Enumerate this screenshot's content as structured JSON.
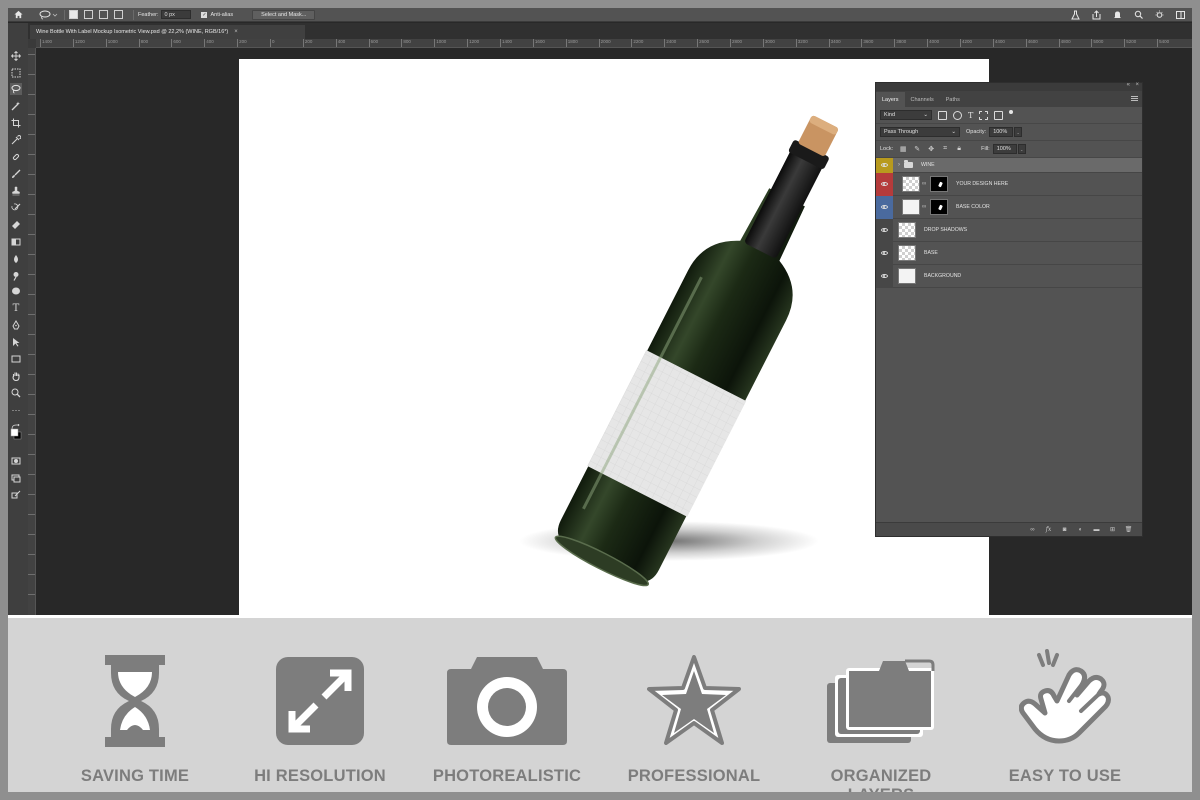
{
  "options_bar": {
    "feather_label": "Feather:",
    "feather_value": "0 px",
    "antialias_label": "Anti-alias",
    "select_mask_label": "Select and Mask..."
  },
  "document": {
    "tab_title": "Wine Bottle With Label Mockup Isometric View.psd @ 22,2% (WINE, RGB/16*)",
    "ruler_ticks": [
      "1400",
      "1200",
      "1000",
      "800",
      "600",
      "400",
      "200",
      "0",
      "200",
      "400",
      "600",
      "800",
      "1000",
      "1200",
      "1400",
      "1600",
      "1800",
      "2000",
      "2200",
      "2400",
      "2600",
      "2800",
      "3000",
      "3200",
      "3400",
      "3600",
      "3800",
      "4000",
      "4200",
      "4400",
      "4600",
      "4800",
      "5000",
      "5200",
      "5400"
    ]
  },
  "layers_panel": {
    "tabs": [
      "Layers",
      "Channels",
      "Paths"
    ],
    "kind_label": "Kind",
    "blend_mode": "Pass Through",
    "opacity_label": "Opacity:",
    "opacity_value": "100%",
    "lock_label": "Lock:",
    "fill_label": "Fill:",
    "fill_value": "100%",
    "layers": [
      {
        "name": "WINE",
        "kind": "group",
        "eye_color": "#b89a1e"
      },
      {
        "name": "YOUR DESIGN HERE",
        "kind": "smart",
        "eye_color": "#b53b3b"
      },
      {
        "name": "BASE COLOR",
        "kind": "fill",
        "eye_color": "#4a6a9e"
      },
      {
        "name": "DROP SHADOWS",
        "kind": "pixel",
        "eye_color": ""
      },
      {
        "name": "BASE",
        "kind": "pixel",
        "eye_color": ""
      },
      {
        "name": "BACKGROUND",
        "kind": "plain",
        "eye_color": ""
      }
    ]
  },
  "features": [
    {
      "label": "SAVING TIME",
      "icon": "hourglass-icon"
    },
    {
      "label": "HI RESOLUTION",
      "icon": "expand-arrows-icon"
    },
    {
      "label": "PHOTOREALISTIC",
      "icon": "camera-icon"
    },
    {
      "label": "PROFESSIONAL",
      "icon": "star-icon"
    },
    {
      "label": "ORGANIZED LAYERS",
      "icon": "stacked-folders-icon"
    },
    {
      "label": "EASY TO USE",
      "icon": "tap-hand-icon"
    }
  ],
  "colors": {
    "icon_gray": "#7d7d7d",
    "strip_bg": "#d4d4d4",
    "app_bg": "#282828",
    "panel_bg": "#535353"
  }
}
